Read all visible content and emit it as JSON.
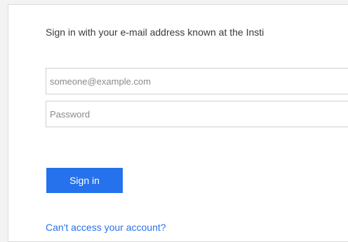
{
  "signin": {
    "heading": "Sign in with your e-mail address known at the Insti",
    "email_placeholder": "someone@example.com",
    "password_placeholder": "Password",
    "button_label": "Sign in",
    "help_link": "Can't access your account?"
  },
  "colors": {
    "accent": "#2672ec",
    "card_background": "#ffffff",
    "page_background": "#f3f3f3"
  }
}
